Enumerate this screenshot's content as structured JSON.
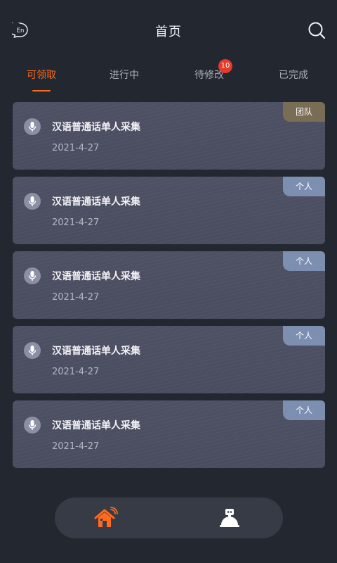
{
  "header": {
    "title": "首页",
    "lang_label": "En",
    "icons": {
      "lang": "language-toggle-icon",
      "search": "search-icon"
    }
  },
  "tabs": [
    {
      "label": "可领取",
      "active": true
    },
    {
      "label": "进行中",
      "active": false
    },
    {
      "label": "待修改",
      "active": false,
      "badge": "10"
    },
    {
      "label": "已完成",
      "active": false
    }
  ],
  "cards": [
    {
      "title": "汉语普通话单人采集",
      "date": "2021-4-27",
      "tag": "团队",
      "tag_type": "team"
    },
    {
      "title": "汉语普通话单人采集",
      "date": "2021-4-27",
      "tag": "个人",
      "tag_type": "person"
    },
    {
      "title": "汉语普通话单人采集",
      "date": "2021-4-27",
      "tag": "个人",
      "tag_type": "person"
    },
    {
      "title": "汉语普通话单人采集",
      "date": "2021-4-27",
      "tag": "个人",
      "tag_type": "person"
    },
    {
      "title": "汉语普通话单人采集",
      "date": "2021-4-27",
      "tag": "个人",
      "tag_type": "person"
    }
  ],
  "bottom_nav": {
    "items": [
      {
        "icon": "home-icon",
        "active": true
      },
      {
        "icon": "robot-icon",
        "active": false
      }
    ]
  },
  "colors": {
    "background": "#23272f",
    "accent": "#ff6a1c",
    "badge": "#e53a2b",
    "card": "#4e5064",
    "tag_team": "#7a6d55",
    "tag_person": "#7d8fb0"
  }
}
